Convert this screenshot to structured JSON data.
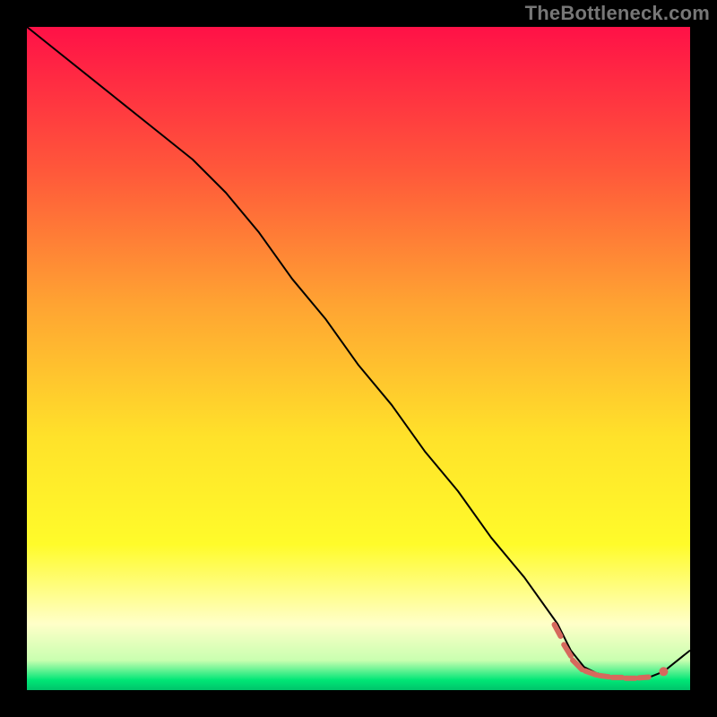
{
  "watermark": "TheBottleneck.com",
  "chart_data": {
    "type": "line",
    "xlabel": "",
    "ylabel": "",
    "xlim": [
      0,
      100
    ],
    "ylim": [
      0,
      100
    ],
    "grid": false,
    "legend": false,
    "background_gradient": {
      "direction": "vertical",
      "stops": [
        {
          "pos": 0.0,
          "color": "#ff1147"
        },
        {
          "pos": 0.22,
          "color": "#ff593a"
        },
        {
          "pos": 0.42,
          "color": "#ffa432"
        },
        {
          "pos": 0.62,
          "color": "#ffe22a"
        },
        {
          "pos": 0.78,
          "color": "#fffb2a"
        },
        {
          "pos": 0.9,
          "color": "#ffffc8"
        },
        {
          "pos": 0.955,
          "color": "#c9ffb0"
        },
        {
          "pos": 0.985,
          "color": "#00e676"
        },
        {
          "pos": 1.0,
          "color": "#00c36a"
        }
      ]
    },
    "series": [
      {
        "name": "bottleneck-curve",
        "color": "#000000",
        "width": 2,
        "x": [
          0,
          5,
          10,
          15,
          20,
          25,
          30,
          35,
          40,
          45,
          50,
          55,
          60,
          65,
          70,
          75,
          80,
          82,
          84,
          86,
          88,
          90,
          92,
          94,
          96,
          100
        ],
        "y": [
          100,
          96,
          92,
          88,
          84,
          80,
          75,
          69,
          62,
          56,
          49,
          43,
          36,
          30,
          23,
          17,
          10,
          6,
          3.5,
          2.5,
          2.0,
          1.8,
          1.8,
          2.0,
          2.8,
          6
        ]
      }
    ],
    "markers": [
      {
        "name": "highlight-dashes",
        "shape": "dash-segment",
        "color": "#d6695d",
        "width": 6,
        "points": [
          {
            "x": 80.0,
            "y": 9.0,
            "len": 2.0,
            "angle": -62
          },
          {
            "x": 81.5,
            "y": 6.0,
            "len": 2.0,
            "angle": -58
          },
          {
            "x": 83.0,
            "y": 3.8,
            "len": 2.0,
            "angle": -45
          },
          {
            "x": 85.0,
            "y": 2.6,
            "len": 1.8,
            "angle": -20
          },
          {
            "x": 87.0,
            "y": 2.1,
            "len": 1.5,
            "angle": -8
          },
          {
            "x": 89.0,
            "y": 1.9,
            "len": 1.5,
            "angle": 0
          },
          {
            "x": 91.0,
            "y": 1.8,
            "len": 1.5,
            "angle": 0
          },
          {
            "x": 93.0,
            "y": 1.9,
            "len": 1.5,
            "angle": 5
          }
        ]
      },
      {
        "name": "highlight-dot",
        "shape": "circle",
        "color": "#d6695d",
        "r": 5,
        "x": 96.0,
        "y": 2.8
      }
    ]
  }
}
